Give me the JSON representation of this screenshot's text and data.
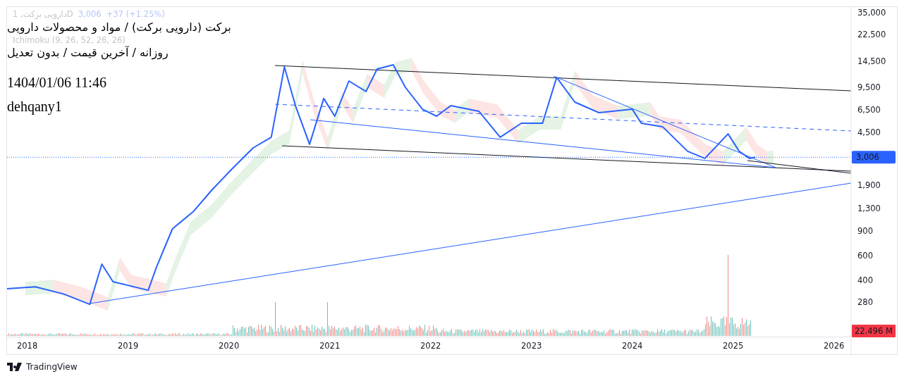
{
  "legend": {
    "symbol": "دارویی برکت, 1D",
    "price": "3,006",
    "change": "+37 (+1.25%)",
    "indicator": "Ichimoku (9, 26, 52, 26, 26)"
  },
  "overlay_texts": [
    "برکت (دارویی برکت) / مواد و محصولات دارویی",
    "روزانه / آخرین قیمت / بدون تعدیل",
    "1404/01/06 11:46",
    "dehqany1"
  ],
  "price_axis": [
    "35,000",
    "22,500",
    "14,500",
    "9,500",
    "6,500",
    "4,500",
    "1,900",
    "1,300",
    "900",
    "600",
    "400",
    "280"
  ],
  "time_axis": [
    "2018",
    "2019",
    "2020",
    "2021",
    "2022",
    "2023",
    "2024",
    "2025",
    "2026"
  ],
  "last_price_label": "3,006",
  "volume_label": "22.496 M",
  "footer": {
    "brand": "TradingView"
  }
}
